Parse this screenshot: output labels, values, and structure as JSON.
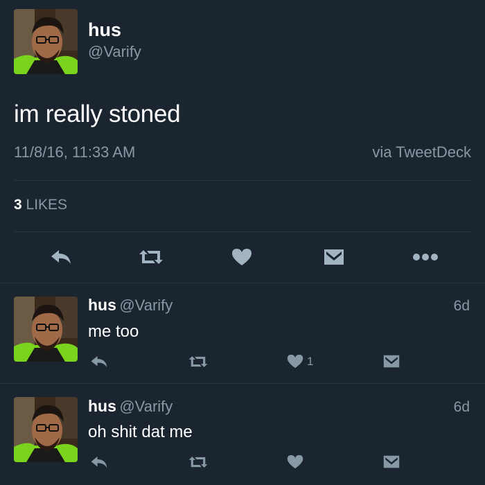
{
  "tweet": {
    "author_name": "hus",
    "author_handle": "@Varify",
    "text": "im really stoned",
    "timestamp": "11/8/16, 11:33 AM",
    "source": "via TweetDeck",
    "likes_count": "3",
    "likes_label": "LIKES"
  },
  "replies": [
    {
      "author_name": "hus",
      "author_handle": "@Varify",
      "age": "6d",
      "text": "me too",
      "like_count": "1"
    },
    {
      "author_name": "hus",
      "author_handle": "@Varify",
      "age": "6d",
      "text": "oh shit dat me",
      "like_count": ""
    }
  ],
  "icons": {
    "reply": "reply-icon",
    "retweet": "retweet-icon",
    "like": "heart-icon",
    "message": "direct-message-icon",
    "more": "more-icon"
  },
  "colors": {
    "background": "#1b2530",
    "text_primary": "#ffffff",
    "text_secondary": "#8899a6",
    "icon": "#a2b3c2",
    "divider": "#2b3642"
  }
}
